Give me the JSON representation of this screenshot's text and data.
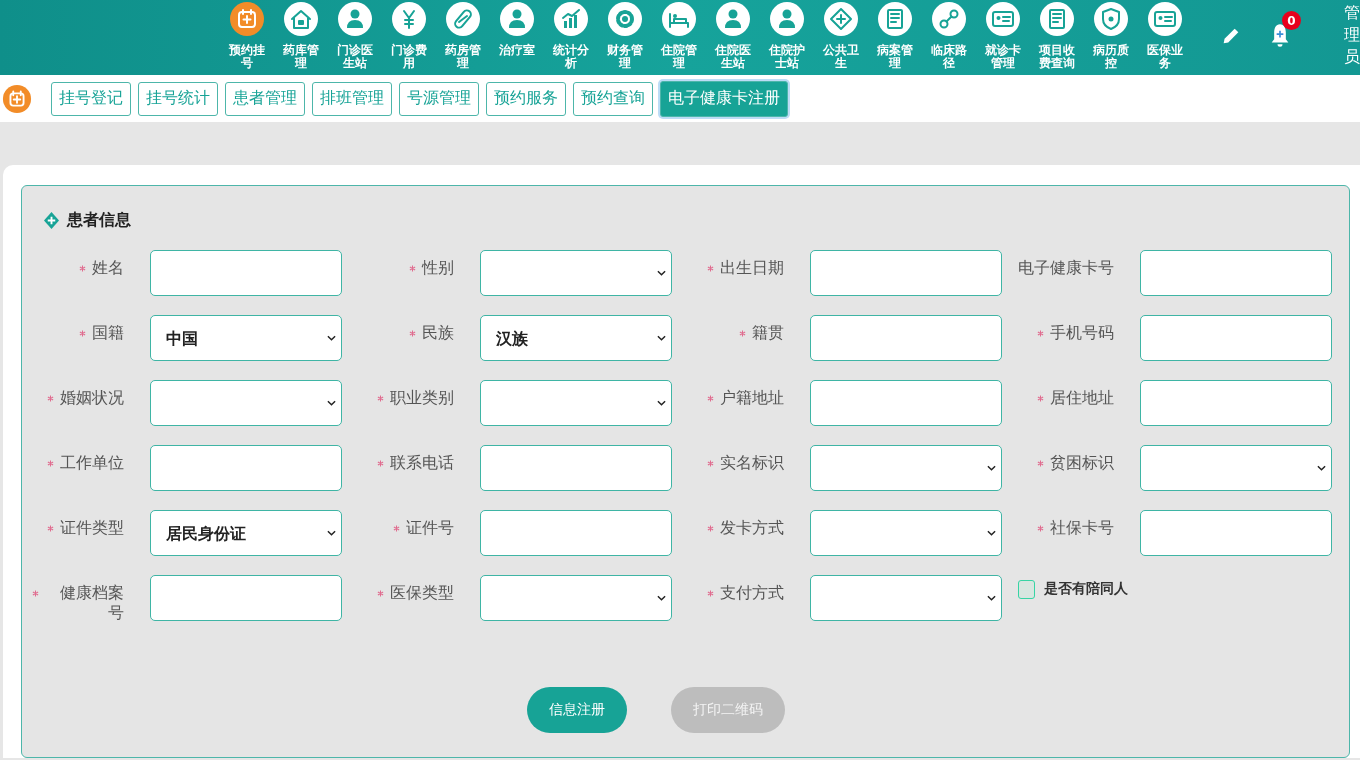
{
  "nav": [
    {
      "label": "预约挂号",
      "selected": true
    },
    {
      "label": "药库管理",
      "selected": false
    },
    {
      "label": "门诊医生站",
      "selected": false
    },
    {
      "label": "门诊费用",
      "selected": false
    },
    {
      "label": "药房管理",
      "selected": false
    },
    {
      "label": "治疗室",
      "selected": false
    },
    {
      "label": "统计分析",
      "selected": false
    },
    {
      "label": "财务管理",
      "selected": false
    },
    {
      "label": "住院管理",
      "selected": false
    },
    {
      "label": "住院医生站",
      "selected": false
    },
    {
      "label": "住院护士站",
      "selected": false
    },
    {
      "label": "公共卫生",
      "selected": false
    },
    {
      "label": "病案管理",
      "selected": false
    },
    {
      "label": "临床路径",
      "selected": false
    },
    {
      "label": "就诊卡管理",
      "selected": false
    },
    {
      "label": "项目收费查询",
      "selected": false
    },
    {
      "label": "病历质控",
      "selected": false
    },
    {
      "label": "医保业务",
      "selected": false
    }
  ],
  "notifications": {
    "badge": "0"
  },
  "user": {
    "name": "管理员"
  },
  "tabs": [
    {
      "label": "挂号登记",
      "selected": false
    },
    {
      "label": "挂号统计",
      "selected": false
    },
    {
      "label": "患者管理",
      "selected": false
    },
    {
      "label": "排班管理",
      "selected": false
    },
    {
      "label": "号源管理",
      "selected": false
    },
    {
      "label": "预约服务",
      "selected": false
    },
    {
      "label": "预约查询",
      "selected": false
    },
    {
      "label": "电子健康卡注册",
      "selected": true
    }
  ],
  "section": {
    "title": "患者信息"
  },
  "fields": [
    {
      "label": "姓名",
      "kind": "text",
      "required": true
    },
    {
      "label": "性别",
      "kind": "select",
      "required": true
    },
    {
      "label": "出生日期",
      "kind": "text",
      "required": true
    },
    {
      "label": "电子健康卡号",
      "kind": "text",
      "required": false
    },
    {
      "label": "国籍",
      "kind": "select",
      "required": true,
      "value": "中国"
    },
    {
      "label": "民族",
      "kind": "select",
      "required": true,
      "value": "汉族"
    },
    {
      "label": "籍贯",
      "kind": "text",
      "required": true
    },
    {
      "label": "手机号码",
      "kind": "text",
      "required": true
    },
    {
      "label": "婚姻状况",
      "kind": "select",
      "required": true
    },
    {
      "label": "职业类别",
      "kind": "select",
      "required": true
    },
    {
      "label": "户籍地址",
      "kind": "text",
      "required": true
    },
    {
      "label": "居住地址",
      "kind": "text",
      "required": true
    },
    {
      "label": "工作单位",
      "kind": "text",
      "required": true
    },
    {
      "label": "联系电话",
      "kind": "text",
      "required": true
    },
    {
      "label": "实名标识",
      "kind": "select",
      "required": true
    },
    {
      "label": "贫困标识",
      "kind": "select",
      "required": true
    },
    {
      "label": "证件类型",
      "kind": "select",
      "required": true,
      "value": "居民身份证"
    },
    {
      "label": "证件号",
      "kind": "text",
      "required": true
    },
    {
      "label": "发卡方式",
      "kind": "select",
      "required": true
    },
    {
      "label": "社保卡号",
      "kind": "text",
      "required": true
    },
    {
      "label": "健康档案号",
      "kind": "text",
      "required": true
    },
    {
      "label": "医保类型",
      "kind": "select",
      "required": true
    },
    {
      "label": "支付方式",
      "kind": "select",
      "required": true
    },
    {
      "label": "是否有陪同人",
      "kind": "checkbox",
      "checked": false
    }
  ],
  "buttons": [
    {
      "label": "信息注册",
      "disabled": false
    },
    {
      "label": "打印二维码",
      "disabled": true
    }
  ]
}
